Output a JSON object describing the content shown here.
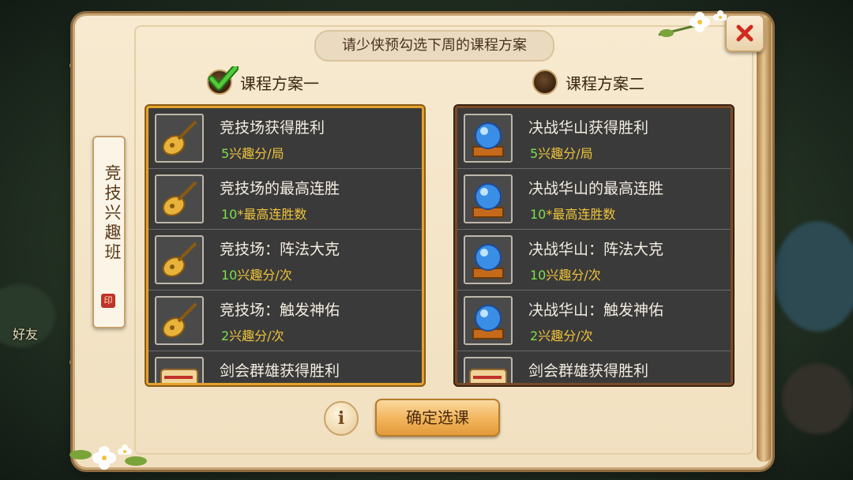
{
  "dialog": {
    "prompt": "请少侠预勾选下周的课程方案",
    "side_tab": "竞技兴趣班",
    "confirm_label": "确定选课",
    "info_label": "i"
  },
  "background": {
    "left_texts": [
      "好友"
    ]
  },
  "plans": [
    {
      "label": "课程方案一",
      "selected": true,
      "items": [
        {
          "title": "竞技场获得胜利",
          "reward_num": "5",
          "reward_text": "兴趣分/局",
          "icon": "pipa-icon"
        },
        {
          "title": "竞技场的最高连胜",
          "reward_num": "10",
          "reward_text": "*最高连胜数",
          "icon": "pipa-icon"
        },
        {
          "title": "竞技场：阵法大克",
          "reward_num": "10",
          "reward_text": "兴趣分/次",
          "icon": "pipa-icon"
        },
        {
          "title": "竞技场：触发神佑",
          "reward_num": "2",
          "reward_text": "兴趣分/次",
          "icon": "pipa-icon"
        },
        {
          "title": "剑会群雄获得胜利",
          "reward_num": "",
          "reward_text": "",
          "icon": "scroll-icon"
        }
      ]
    },
    {
      "label": "课程方案二",
      "selected": false,
      "items": [
        {
          "title": "决战华山获得胜利",
          "reward_num": "5",
          "reward_text": "兴趣分/局",
          "icon": "crystal-ball-icon"
        },
        {
          "title": "决战华山的最高连胜",
          "reward_num": "10",
          "reward_text": "*最高连胜数",
          "icon": "crystal-ball-icon"
        },
        {
          "title": "决战华山：阵法大克",
          "reward_num": "10",
          "reward_text": "兴趣分/次",
          "icon": "crystal-ball-icon"
        },
        {
          "title": "决战华山：触发神佑",
          "reward_num": "2",
          "reward_text": "兴趣分/次",
          "icon": "crystal-ball-icon"
        },
        {
          "title": "剑会群雄获得胜利",
          "reward_num": "",
          "reward_text": "",
          "icon": "scroll-icon"
        }
      ]
    }
  ],
  "colors": {
    "selected_border": "#e3a22b",
    "reward_number": "#7be04e",
    "reward_text": "#f0c43a"
  }
}
